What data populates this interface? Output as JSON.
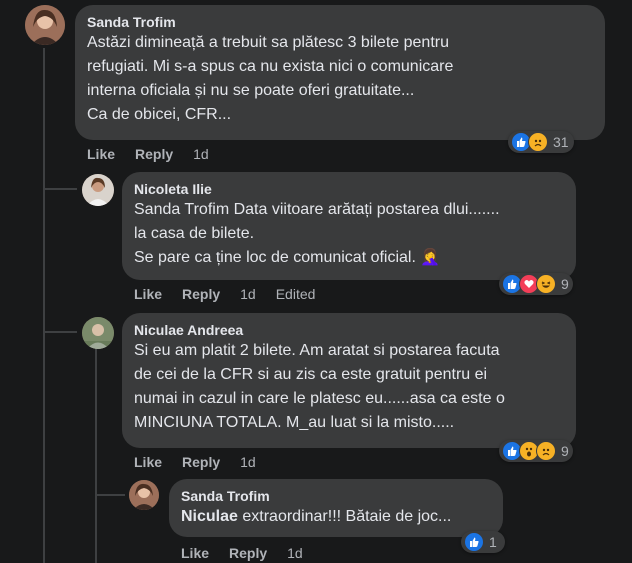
{
  "comments": [
    {
      "author": "Sanda Trofim",
      "text": "Astăzi dimineață a trebuit sa plătesc 3 bilete pentru\nrefugiati. Mi s-a spus ca nu exista nici o comunicare\ninterna oficiala și nu se poate oferi gratuitate...\nCa de obicei, CFR...",
      "like": "Like",
      "reply": "Reply",
      "time": "1d",
      "reactions": [
        "like-icon",
        "sad-icon"
      ],
      "count": "31"
    },
    {
      "author": "Nicoleta Ilie",
      "text": "Sanda Trofim Data viitoare arătați postarea dlui.......\nla casa de bilete.\nSe pare ca ține loc de comunicat oficial.",
      "emoji": "🤦‍♀️",
      "like": "Like",
      "reply": "Reply",
      "time": "1d",
      "edited": "Edited",
      "reactions": [
        "like-icon",
        "love-icon",
        "haha-icon"
      ],
      "count": "9"
    },
    {
      "author": "Niculae Andreea",
      "text": "Si eu am platit 2 bilete. Am aratat si postarea facuta\nde cei de la CFR si au zis ca este gratuit pentru ei\nnumai in cazul in care le platesc eu......asa ca este o\nMINCIUNA TOTALA. M_au luat si la misto.....",
      "like": "Like",
      "reply": "Reply",
      "time": "1d",
      "reactions": [
        "like-icon",
        "wow-icon",
        "sad-icon"
      ],
      "count": "9"
    },
    {
      "author": "Sanda Trofim",
      "mention": "Niculae",
      "text": " extraordinar!!! Bătaie de joc...",
      "like": "Like",
      "reply": "Reply",
      "time": "1d",
      "reactions": [
        "like-icon"
      ],
      "count": "1"
    }
  ],
  "colors": {
    "bg": "#18191a",
    "bubble": "#3a3b3c",
    "like": "#1b74e4",
    "love": "#f33e58",
    "emoji": "#f7b125"
  }
}
